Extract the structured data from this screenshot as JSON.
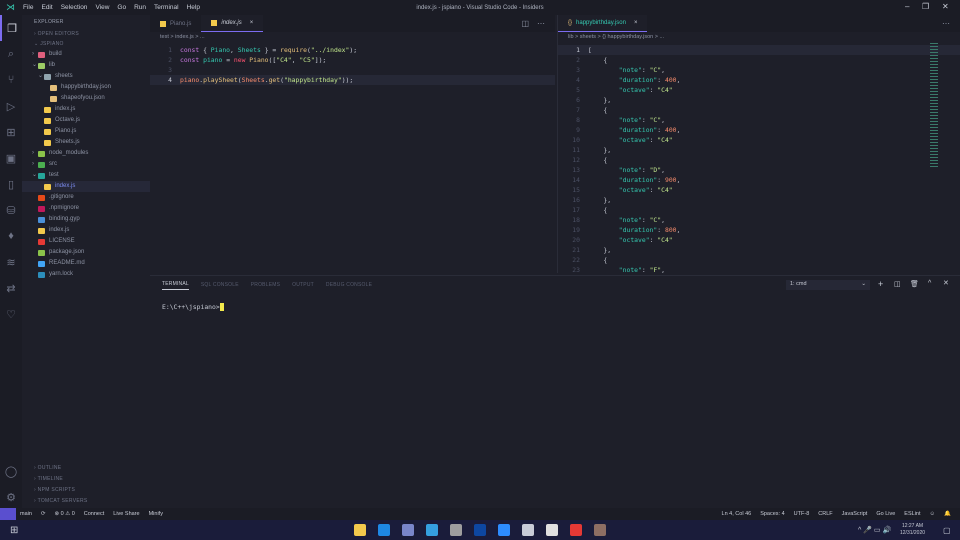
{
  "titlebar": {
    "menu": [
      "File",
      "Edit",
      "Selection",
      "View",
      "Go",
      "Run",
      "Terminal",
      "Help"
    ],
    "title": "index.js - jspiano - Visual Studio Code - Insiders"
  },
  "activity": [
    "files-icon",
    "search-icon",
    "source-control-icon",
    "run-debug-icon",
    "extensions-icon",
    "remote-explorer-icon",
    "devices-icon",
    "database-icon",
    "mongodb-icon",
    "docker-icon",
    "live-share-icon",
    "heart-icon"
  ],
  "sidebar": {
    "title": "EXPLORER",
    "open_editors": "OPEN EDITORS",
    "project": "JSPIANO",
    "tree": [
      {
        "label": "build",
        "depth": 1,
        "color": "#e0607e",
        "arrow": ">"
      },
      {
        "label": "lib",
        "depth": 1,
        "color": "#9ccc65",
        "arrow": "v"
      },
      {
        "label": "sheets",
        "depth": 2,
        "color": "#90a4ae",
        "arrow": "v"
      },
      {
        "label": "happybirthday.json",
        "depth": 3,
        "color": "#e6c07b"
      },
      {
        "label": "shapeofyou.json",
        "depth": 3,
        "color": "#e6c07b"
      },
      {
        "label": "index.js",
        "depth": 2,
        "color": "#f2c94c"
      },
      {
        "label": "Octave.js",
        "depth": 2,
        "color": "#f2c94c"
      },
      {
        "label": "Piano.js",
        "depth": 2,
        "color": "#f2c94c"
      },
      {
        "label": "Sheets.js",
        "depth": 2,
        "color": "#f2c94c"
      },
      {
        "label": "node_modules",
        "depth": 1,
        "color": "#8bc34a",
        "arrow": ">"
      },
      {
        "label": "src",
        "depth": 1,
        "color": "#4caf50",
        "arrow": ">"
      },
      {
        "label": "test",
        "depth": 1,
        "color": "#26a69a",
        "arrow": "v"
      },
      {
        "label": "index.js",
        "depth": 2,
        "color": "#f2c94c",
        "selected": true
      },
      {
        "label": ".gitignore",
        "depth": 1,
        "color": "#e64a19"
      },
      {
        "label": ".npmignore",
        "depth": 1,
        "color": "#c2185b"
      },
      {
        "label": "binding.gyp",
        "depth": 1,
        "color": "#4a90d9"
      },
      {
        "label": "index.js",
        "depth": 1,
        "color": "#f2c94c"
      },
      {
        "label": "LICENSE",
        "depth": 1,
        "color": "#e53935"
      },
      {
        "label": "package.json",
        "depth": 1,
        "color": "#8bc34a"
      },
      {
        "label": "README.md",
        "depth": 1,
        "color": "#42a5f5"
      },
      {
        "label": "yarn.lock",
        "depth": 1,
        "color": "#2c8ebb"
      }
    ],
    "bottom": [
      "OUTLINE",
      "TIMELINE",
      "NPM SCRIPTS",
      "TOMCAT SERVERS"
    ]
  },
  "editor1": {
    "tabs": [
      {
        "label": "Piano.js",
        "active": false
      },
      {
        "label": "index.js",
        "active": true,
        "close": "×"
      }
    ],
    "breadcrumb": "test > index.js > ...",
    "lines": [
      [
        [
          "const ",
          "k"
        ],
        [
          "{ ",
          "p"
        ],
        [
          "Piano",
          "v"
        ],
        [
          ", ",
          "p"
        ],
        [
          "Sheets",
          "v"
        ],
        [
          " } = ",
          "p"
        ],
        [
          "require",
          "f"
        ],
        [
          "(",
          "p"
        ],
        [
          "\"../index\"",
          "s"
        ],
        [
          ");",
          "p"
        ]
      ],
      [
        [
          "const ",
          "k"
        ],
        [
          "piano",
          "v"
        ],
        [
          " = ",
          "p"
        ],
        [
          "new ",
          "r"
        ],
        [
          "Piano",
          "f"
        ],
        [
          "([",
          "p"
        ],
        [
          "\"C4\"",
          "s"
        ],
        [
          ", ",
          "p"
        ],
        [
          "\"C5\"",
          "s"
        ],
        [
          "]);",
          "p"
        ]
      ],
      [],
      [
        [
          "piano",
          "n"
        ],
        [
          ".",
          "p"
        ],
        [
          "playSheet",
          "f"
        ],
        [
          "(",
          "p"
        ],
        [
          "Sheets",
          "n"
        ],
        [
          ".",
          "p"
        ],
        [
          "get",
          "f"
        ],
        [
          "(",
          "p"
        ],
        [
          "\"happybirthday\"",
          "s"
        ],
        [
          "));",
          "p"
        ]
      ]
    ],
    "cursor_line": 4
  },
  "editor2": {
    "tabs": [
      {
        "label": "happybirthday.json",
        "active": true,
        "close": "×"
      }
    ],
    "breadcrumb": "lib > sheets > {} happybirthday.json > ...",
    "lines": [
      [
        [
          "[",
          "p"
        ]
      ],
      [
        [
          "    {",
          "p"
        ]
      ],
      [
        [
          "        \"note\"",
          "key"
        ],
        [
          ": ",
          "p"
        ],
        [
          "\"C\"",
          "st"
        ],
        [
          ",",
          "p"
        ]
      ],
      [
        [
          "        \"duration\"",
          "key"
        ],
        [
          ": ",
          "p"
        ],
        [
          "400",
          "n"
        ],
        [
          ",",
          "p"
        ]
      ],
      [
        [
          "        \"octave\"",
          "key"
        ],
        [
          ": ",
          "p"
        ],
        [
          "\"C4\"",
          "st"
        ]
      ],
      [
        [
          "    },",
          "p"
        ]
      ],
      [
        [
          "    {",
          "p"
        ]
      ],
      [
        [
          "        \"note\"",
          "key"
        ],
        [
          ": ",
          "p"
        ],
        [
          "\"C\"",
          "st"
        ],
        [
          ",",
          "p"
        ]
      ],
      [
        [
          "        \"duration\"",
          "key"
        ],
        [
          ": ",
          "p"
        ],
        [
          "400",
          "n"
        ],
        [
          ",",
          "p"
        ]
      ],
      [
        [
          "        \"octave\"",
          "key"
        ],
        [
          ": ",
          "p"
        ],
        [
          "\"C4\"",
          "st"
        ]
      ],
      [
        [
          "    },",
          "p"
        ]
      ],
      [
        [
          "    {",
          "p"
        ]
      ],
      [
        [
          "        \"note\"",
          "key"
        ],
        [
          ": ",
          "p"
        ],
        [
          "\"D\"",
          "st"
        ],
        [
          ",",
          "p"
        ]
      ],
      [
        [
          "        \"duration\"",
          "key"
        ],
        [
          ": ",
          "p"
        ],
        [
          "900",
          "n"
        ],
        [
          ",",
          "p"
        ]
      ],
      [
        [
          "        \"octave\"",
          "key"
        ],
        [
          ": ",
          "p"
        ],
        [
          "\"C4\"",
          "st"
        ]
      ],
      [
        [
          "    },",
          "p"
        ]
      ],
      [
        [
          "    {",
          "p"
        ]
      ],
      [
        [
          "        \"note\"",
          "key"
        ],
        [
          ": ",
          "p"
        ],
        [
          "\"C\"",
          "st"
        ],
        [
          ",",
          "p"
        ]
      ],
      [
        [
          "        \"duration\"",
          "key"
        ],
        [
          ": ",
          "p"
        ],
        [
          "800",
          "n"
        ],
        [
          ",",
          "p"
        ]
      ],
      [
        [
          "        \"octave\"",
          "key"
        ],
        [
          ": ",
          "p"
        ],
        [
          "\"C4\"",
          "st"
        ]
      ],
      [
        [
          "    },",
          "p"
        ]
      ],
      [
        [
          "    {",
          "p"
        ]
      ],
      [
        [
          "        \"note\"",
          "key"
        ],
        [
          ": ",
          "p"
        ],
        [
          "\"F\"",
          "st"
        ],
        [
          ",",
          "p"
        ]
      ]
    ],
    "cursor_line": 1
  },
  "panel": {
    "tabs": [
      "TERMINAL",
      "SQL CONSOLE",
      "PROBLEMS",
      "OUTPUT",
      "DEBUG CONSOLE"
    ],
    "active": 0,
    "terminal_select": "1: cmd",
    "prompt": "E:\\C++\\jspiano>"
  },
  "status": {
    "left": [
      "main",
      "⟳",
      "⊗ 0 ⚠ 0",
      "Connect",
      "Live Share",
      "Minify"
    ],
    "right": [
      "Ln 4, Col 46",
      "Spaces: 4",
      "UTF-8",
      "CRLF",
      "JavaScript",
      "Go Live",
      "ESLint"
    ]
  },
  "taskbar": {
    "time": "12:27 AM",
    "date": "12/31/2020",
    "apps": [
      "#f2c94c",
      "#1e88e5",
      "#7986cb",
      "#35a0e0",
      "#9e9e9e",
      "#0d47a1",
      "#2d8cff",
      "#c8ccd6",
      "#e0e0e0",
      "#e53935",
      "#8d6e63"
    ]
  }
}
